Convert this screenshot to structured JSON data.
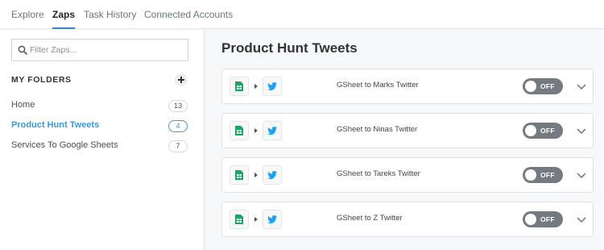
{
  "tabs": [
    "Explore",
    "Zaps",
    "Task History",
    "Connected Accounts"
  ],
  "active_tab": "Zaps",
  "search": {
    "placeholder": "Filter Zaps...",
    "icon": "search-icon"
  },
  "sidebar": {
    "folders_title": "MY FOLDERS",
    "add_icon": "plus-icon",
    "folders": [
      {
        "name": "Home",
        "count": "13",
        "active": false
      },
      {
        "name": "Product Hunt Tweets",
        "count": "4",
        "active": true
      },
      {
        "name": "Services To Google Sheets",
        "count": "7",
        "active": false
      }
    ]
  },
  "main": {
    "title": "Product Hunt Tweets",
    "zaps": [
      {
        "name": "GSheet to Marks Twitter",
        "status": "OFF"
      },
      {
        "name": "GSheet to Ninas Twitter",
        "status": "OFF"
      },
      {
        "name": "GSheet to Tareks Twitter",
        "status": "OFF"
      },
      {
        "name": "GSheet to Z Twitter",
        "status": "OFF"
      }
    ]
  },
  "colors": {
    "accent": "#3a9ad9",
    "tab_underline": "#3a83c8",
    "toggle_off": "#747a80",
    "sheets_green": "#1fa463",
    "twitter_blue": "#1da1f2"
  }
}
